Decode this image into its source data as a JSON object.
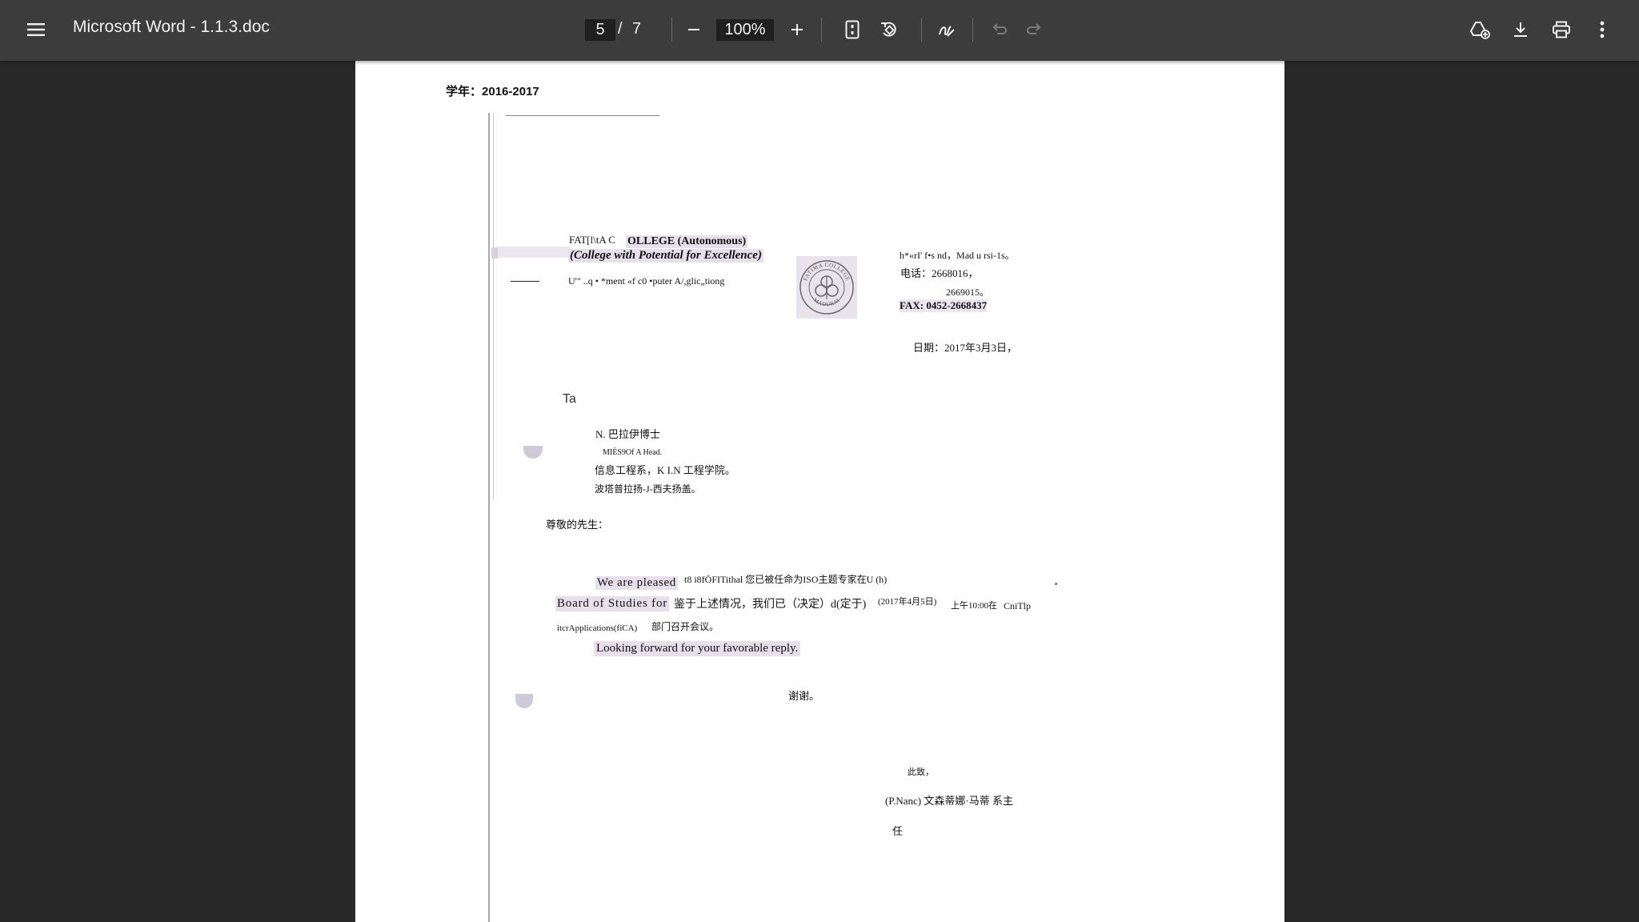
{
  "toolbar": {
    "menu_icon": "hamburger-menu-icon",
    "title": "Microsoft Word - 1.1.3.doc",
    "page_current": "5",
    "page_separator": "/",
    "page_total": "7",
    "zoom": "100%",
    "icons": [
      "zoom-out-icon",
      "zoom-in-icon",
      "fit-page-icon",
      "rotate-icon",
      "annotate-pen-icon",
      "undo-icon",
      "redo-icon",
      "save-to-drive-icon",
      "download-icon",
      "print-icon",
      "more-vert-icon"
    ]
  },
  "document": {
    "academic_year_label": "学年：",
    "academic_year": "2016-2017",
    "letterhead": {
      "college_prefix": "FAT[l\\tA C",
      "college_name": "OLLEGE (Autonomous)",
      "college_tagline": "(College with Potential for Excellence)",
      "department": "U'\"  ..q • *ment «f c0 •puter A/,glic„tiong",
      "seal_text_top": "FATIMA COLLEGE",
      "seal_text_bottom": "MADURAI",
      "address_line": "h*«rI' f•s nd，Mad u rsi-1s。",
      "phone_label": "电话：",
      "phone_1": "2668016，",
      "phone_2": "2669015。",
      "fax": "FAX: 0452-2668437"
    },
    "date_label": "日期：",
    "date_value": "2017年3月3日，",
    "to_label": "Ta",
    "recipient": {
      "name": "N. 巴拉伊博士",
      "title": "MIÈS9Of A Head.",
      "dept": "信息工程系，K I.N 工程学院。",
      "place": "波塔普拉扬-J-西夫扬盖。"
    },
    "salutation": "尊敬的先生：",
    "body": {
      "l1_a": "We are pleased",
      "l1_b": "t8 i8fÖFITithal 您已被任命为ISO主题专家在U (h)",
      "l2_a": "Board of Studies for",
      "l2_b": "鉴于上述情况，我们已（决定）d(定于)",
      "l2_c": "(2017年4月5日)",
      "l2_d": "上午10:00在",
      "l2_e": "CniTlp",
      "l3_a": "itcrApplications(fiCA)",
      "l3_b": "部门召开会议。",
      "l4": "Looking forward for your favorable reply."
    },
    "thanks": "谢谢。",
    "closing": "此致，",
    "signature_name": "(P.Nanc) 文森蒂娜·马蒂 系主",
    "signature_role": "任"
  }
}
